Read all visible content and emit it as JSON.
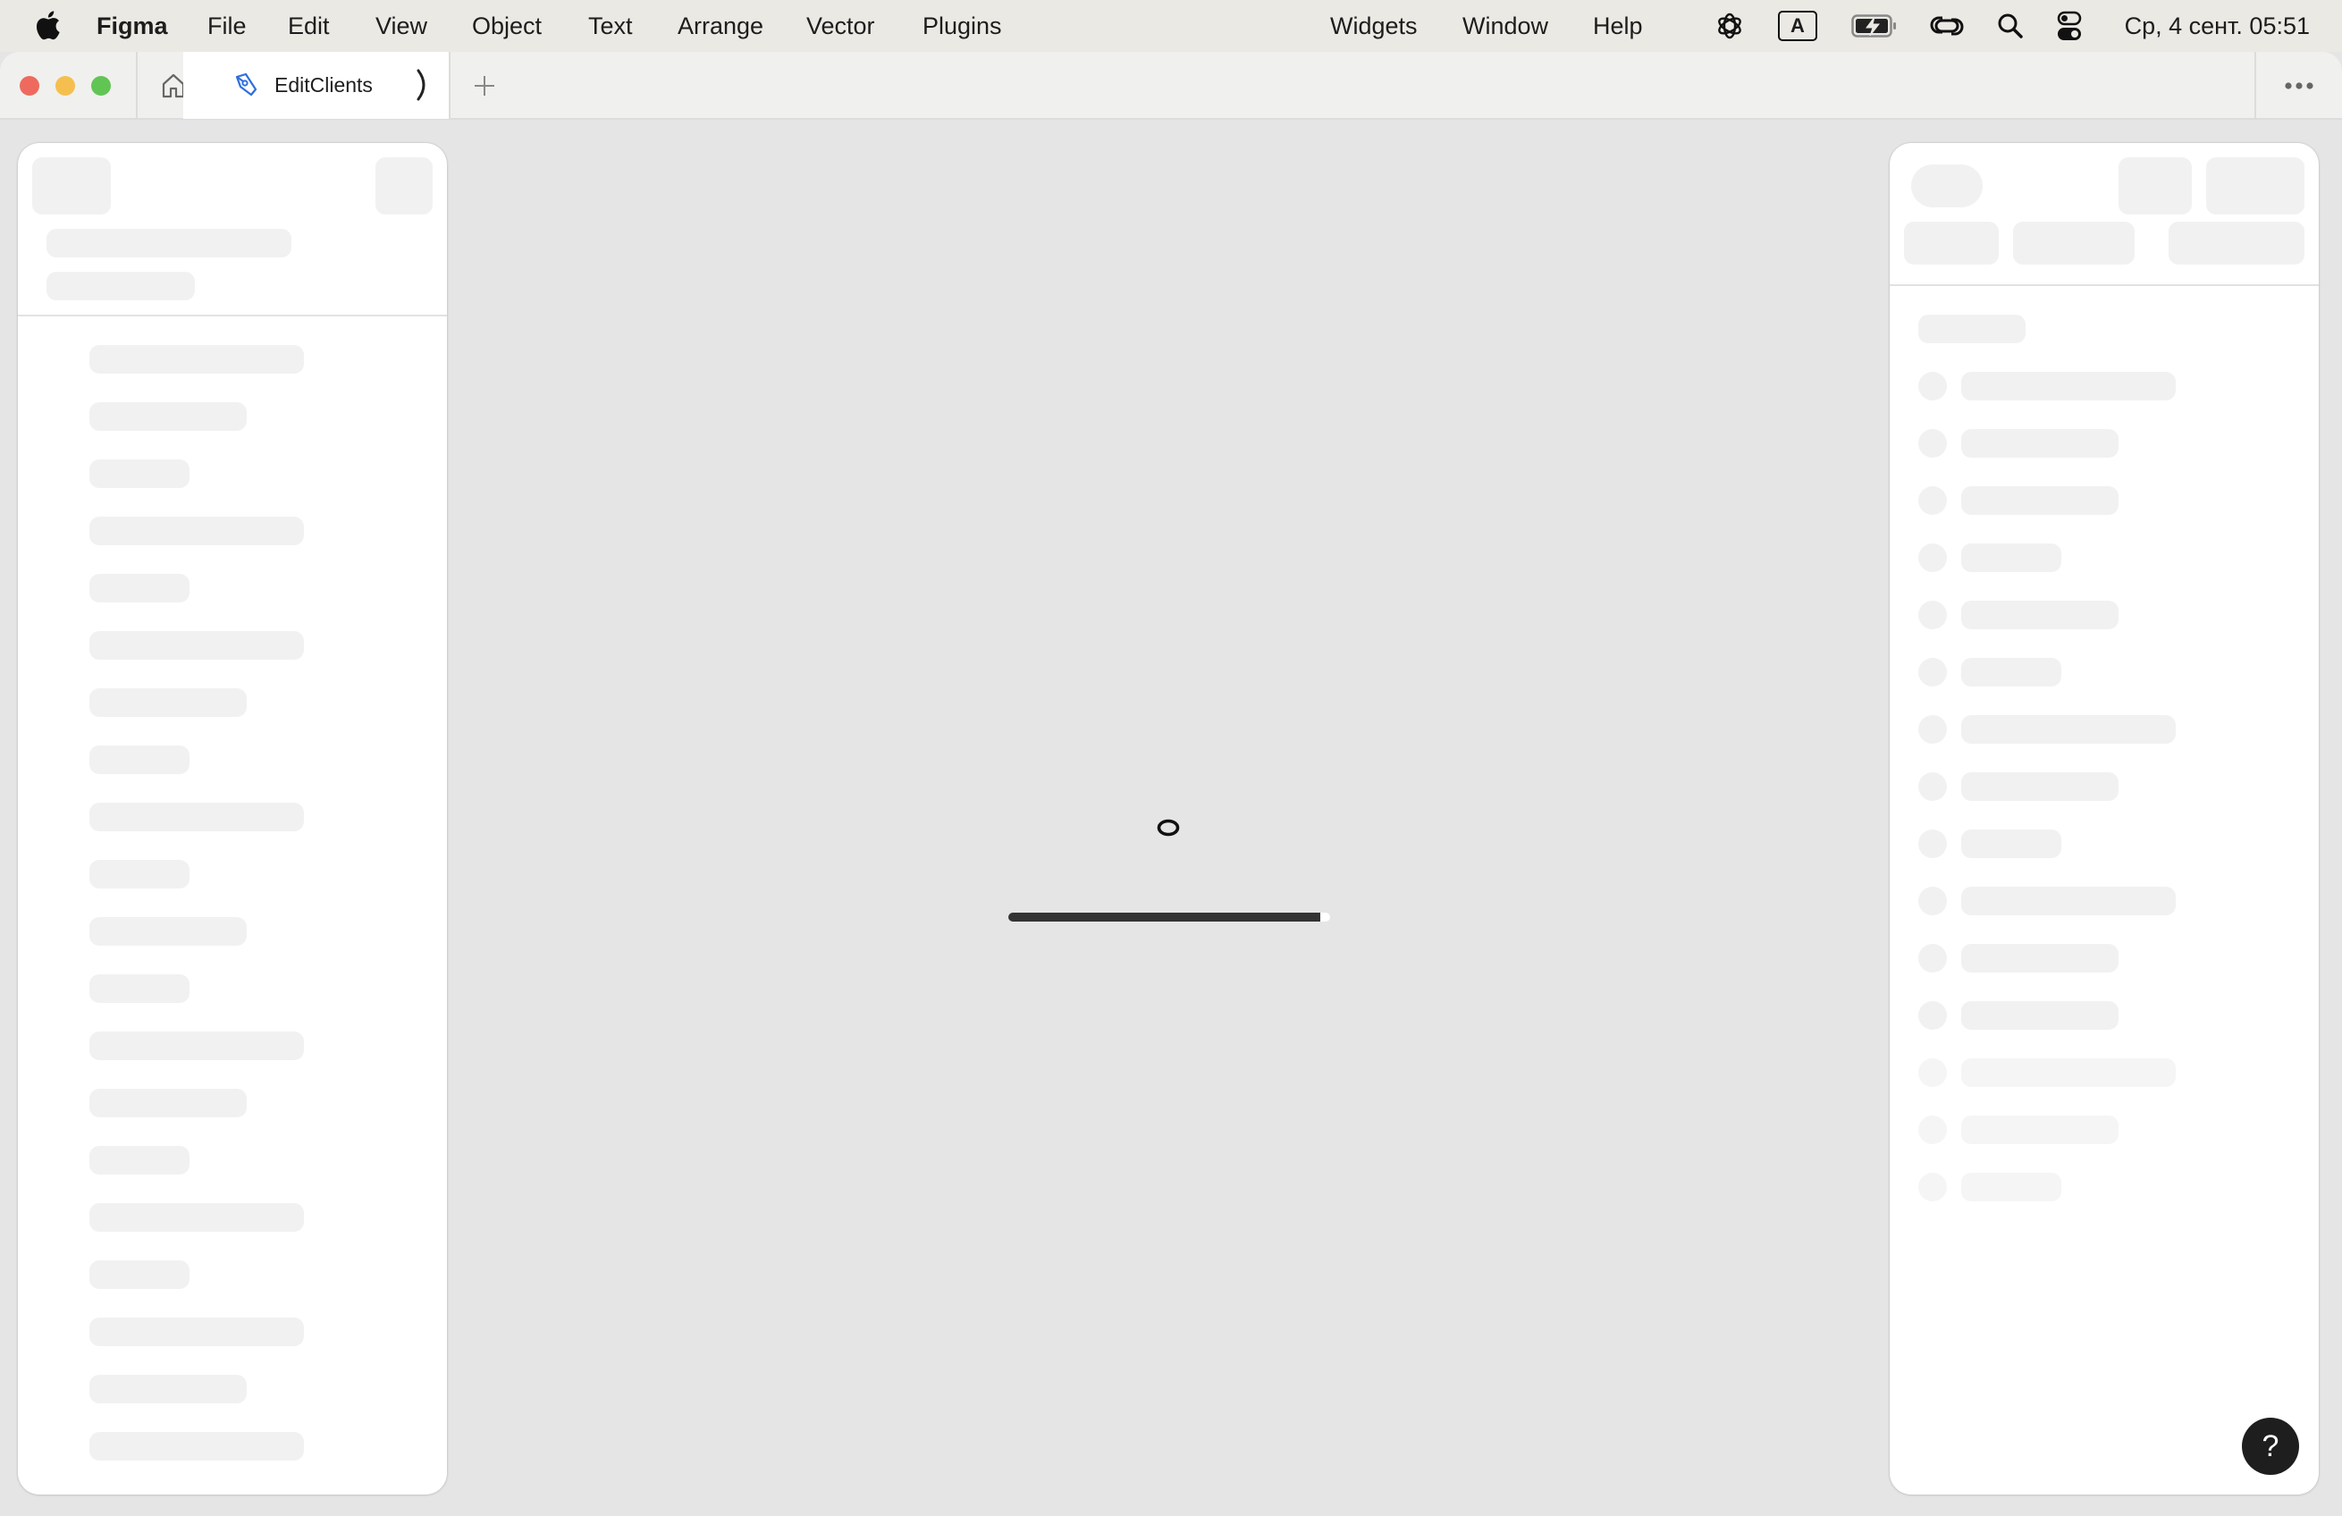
{
  "menubar": {
    "app_name": "Figma",
    "items": [
      "File",
      "Edit",
      "View",
      "Object",
      "Text",
      "Arrange",
      "Vector",
      "Plugins",
      "Widgets",
      "Window",
      "Help"
    ],
    "tray_icons": [
      "chatgpt-icon",
      "input-source-icon",
      "battery-charging-icon",
      "link-icon",
      "spotlight-search-icon",
      "control-center-icon"
    ],
    "input_source_label": "A",
    "clock": "Ср, 4 сент.  05:51"
  },
  "tabbar": {
    "active_tab": {
      "title": "EditClients",
      "icon": "figma-pen-icon",
      "loading": true
    },
    "home_icon": "home-icon",
    "new_tab_icon": "plus-icon",
    "more_icon": "ellipsis-icon"
  },
  "canvas": {
    "loading_glyph": "o",
    "progress": 0.97
  },
  "left_panel": {
    "state": "loading-skeleton",
    "rows": 20
  },
  "right_panel": {
    "state": "loading-skeleton",
    "rows": 15
  },
  "help_button": {
    "label": "?"
  },
  "colors": {
    "canvas_bg": "#e5e5e5",
    "panel_bg": "#ffffff",
    "skeleton": "#f1f1f1",
    "progress_fill": "#333333",
    "accent_tab_icon": "#2f6fdc"
  }
}
